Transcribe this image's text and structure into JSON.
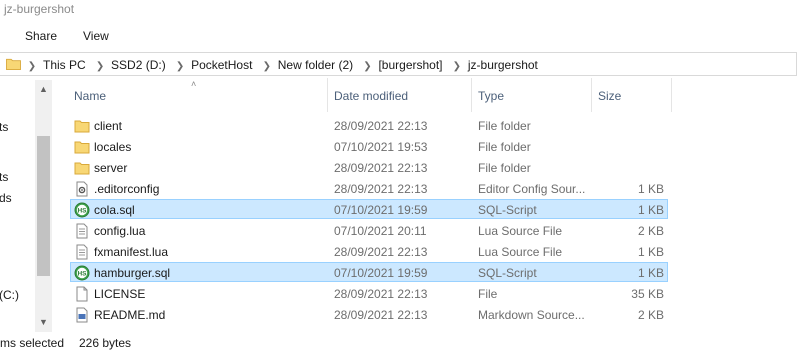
{
  "window": {
    "title": "jz-burgershot"
  },
  "ribbon": {
    "tabs": [
      "Share",
      "View"
    ]
  },
  "address": {
    "crumbs": [
      "This PC",
      "SSD2 (D:)",
      "PocketHost",
      "New folder (2)",
      "[burgershot]",
      "jz-burgershot"
    ]
  },
  "nav": {
    "items": [
      "ts",
      "ts",
      "ds",
      "(C:)"
    ]
  },
  "columns": {
    "name": "Name",
    "date": "Date modified",
    "type": "Type",
    "size": "Size"
  },
  "files": [
    {
      "name": "client",
      "date": "28/09/2021 22:13",
      "type": "File folder",
      "size": "",
      "icon": "folder-icon",
      "selected": false
    },
    {
      "name": "locales",
      "date": "07/10/2021 19:53",
      "type": "File folder",
      "size": "",
      "icon": "folder-icon",
      "selected": false
    },
    {
      "name": "server",
      "date": "28/09/2021 22:13",
      "type": "File folder",
      "size": "",
      "icon": "folder-icon",
      "selected": false
    },
    {
      "name": ".editorconfig",
      "date": "28/09/2021 22:13",
      "type": "Editor Config Sour...",
      "size": "1 KB",
      "icon": "config-file-icon",
      "selected": false
    },
    {
      "name": "cola.sql",
      "date": "07/10/2021 19:59",
      "type": "SQL-Script",
      "size": "1 KB",
      "icon": "sql-script-icon",
      "selected": true
    },
    {
      "name": "config.lua",
      "date": "07/10/2021 20:11",
      "type": "Lua Source File",
      "size": "2 KB",
      "icon": "document-icon",
      "selected": false
    },
    {
      "name": "fxmanifest.lua",
      "date": "28/09/2021 22:13",
      "type": "Lua Source File",
      "size": "1 KB",
      "icon": "document-icon",
      "selected": false
    },
    {
      "name": "hamburger.sql",
      "date": "07/10/2021 19:59",
      "type": "SQL-Script",
      "size": "1 KB",
      "icon": "sql-script-icon",
      "selected": true
    },
    {
      "name": "LICENSE",
      "date": "28/09/2021 22:13",
      "type": "File",
      "size": "35 KB",
      "icon": "blank-file-icon",
      "selected": false
    },
    {
      "name": "README.md",
      "date": "28/09/2021 22:13",
      "type": "Markdown Source...",
      "size": "2 KB",
      "icon": "markdown-file-icon",
      "selected": false
    }
  ],
  "status": {
    "selection": "ms selected",
    "bytes": "226 bytes"
  },
  "colors": {
    "folder": "#f8d775",
    "selection_bg": "#cce8ff",
    "selection_border": "#99d1ff",
    "header_text": "#4c607a"
  }
}
